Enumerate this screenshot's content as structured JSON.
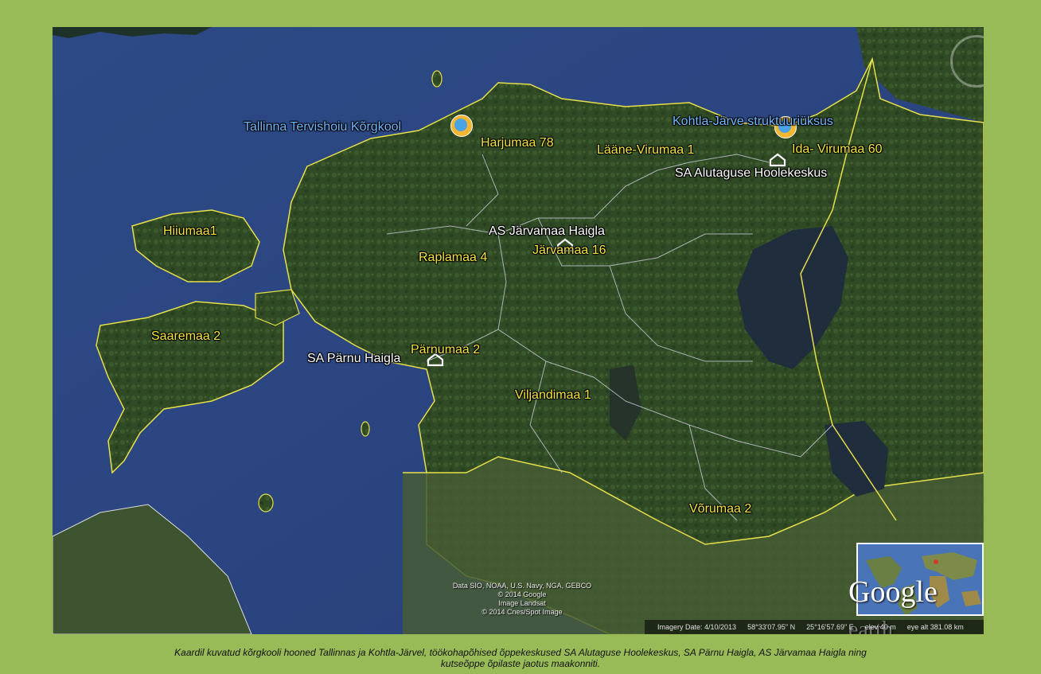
{
  "map": {
    "county_labels": [
      {
        "text": "Harjumaa 78"
      },
      {
        "text": "Lääne-Virumaa 1"
      },
      {
        "text": "Ida- Virumaa 60"
      },
      {
        "text": "Hiiumaa1"
      },
      {
        "text": "Raplamaa 4"
      },
      {
        "text": "Järvamaa 16"
      },
      {
        "text": "Saaremaa 2"
      },
      {
        "text": "Pärnumaa 2"
      },
      {
        "text": "Viljandimaa 1"
      },
      {
        "text": "Võrumaa 2"
      }
    ],
    "schools": [
      {
        "text": "Tallinna Tervishoiu Kõrgkool",
        "icon": "school-icon"
      },
      {
        "text": "Kohtla-Järve struktuuriüksus",
        "icon": "school-icon"
      }
    ],
    "places": [
      {
        "text": "SA Alutaguse Hoolekeskus",
        "icon": "house-icon"
      },
      {
        "text": "AS Järvamaa Haigla",
        "icon": "house-icon"
      },
      {
        "text": "SA Pärnu Haigla",
        "icon": "house-icon"
      }
    ],
    "credits": [
      "Data SIO, NOAA, U.S. Navy, NGA, GEBCO",
      "© 2014 Google",
      "Image Landsat",
      "© 2014 Cnes/Spot Image"
    ],
    "status": {
      "imagery_date": "Imagery Date: 4/10/2013",
      "lat": "58°33'07.95\" N",
      "lon": "25°16'57.69\" E",
      "elev": "elev   40 m",
      "eye_alt": "eye alt 381.08 km"
    },
    "logo": {
      "google": "Google",
      "earth": "earth"
    },
    "colors": {
      "county_label": "#f3e33a",
      "school_label": "#6fb7ff",
      "border": "#e8e04a",
      "background": "#98bb58"
    }
  },
  "caption": {
    "line1": "Kaardil kuvatud kõrgkooli hooned Tallinnas ja Kohtla-Järvel, töökohapõhised õppekeskused SA Alutaguse Hoolekeskus, SA Pärnu Haigla, AS Järvamaa Haigla ning",
    "line2": "kutseõppe õpilaste jaotus maakonniti."
  }
}
